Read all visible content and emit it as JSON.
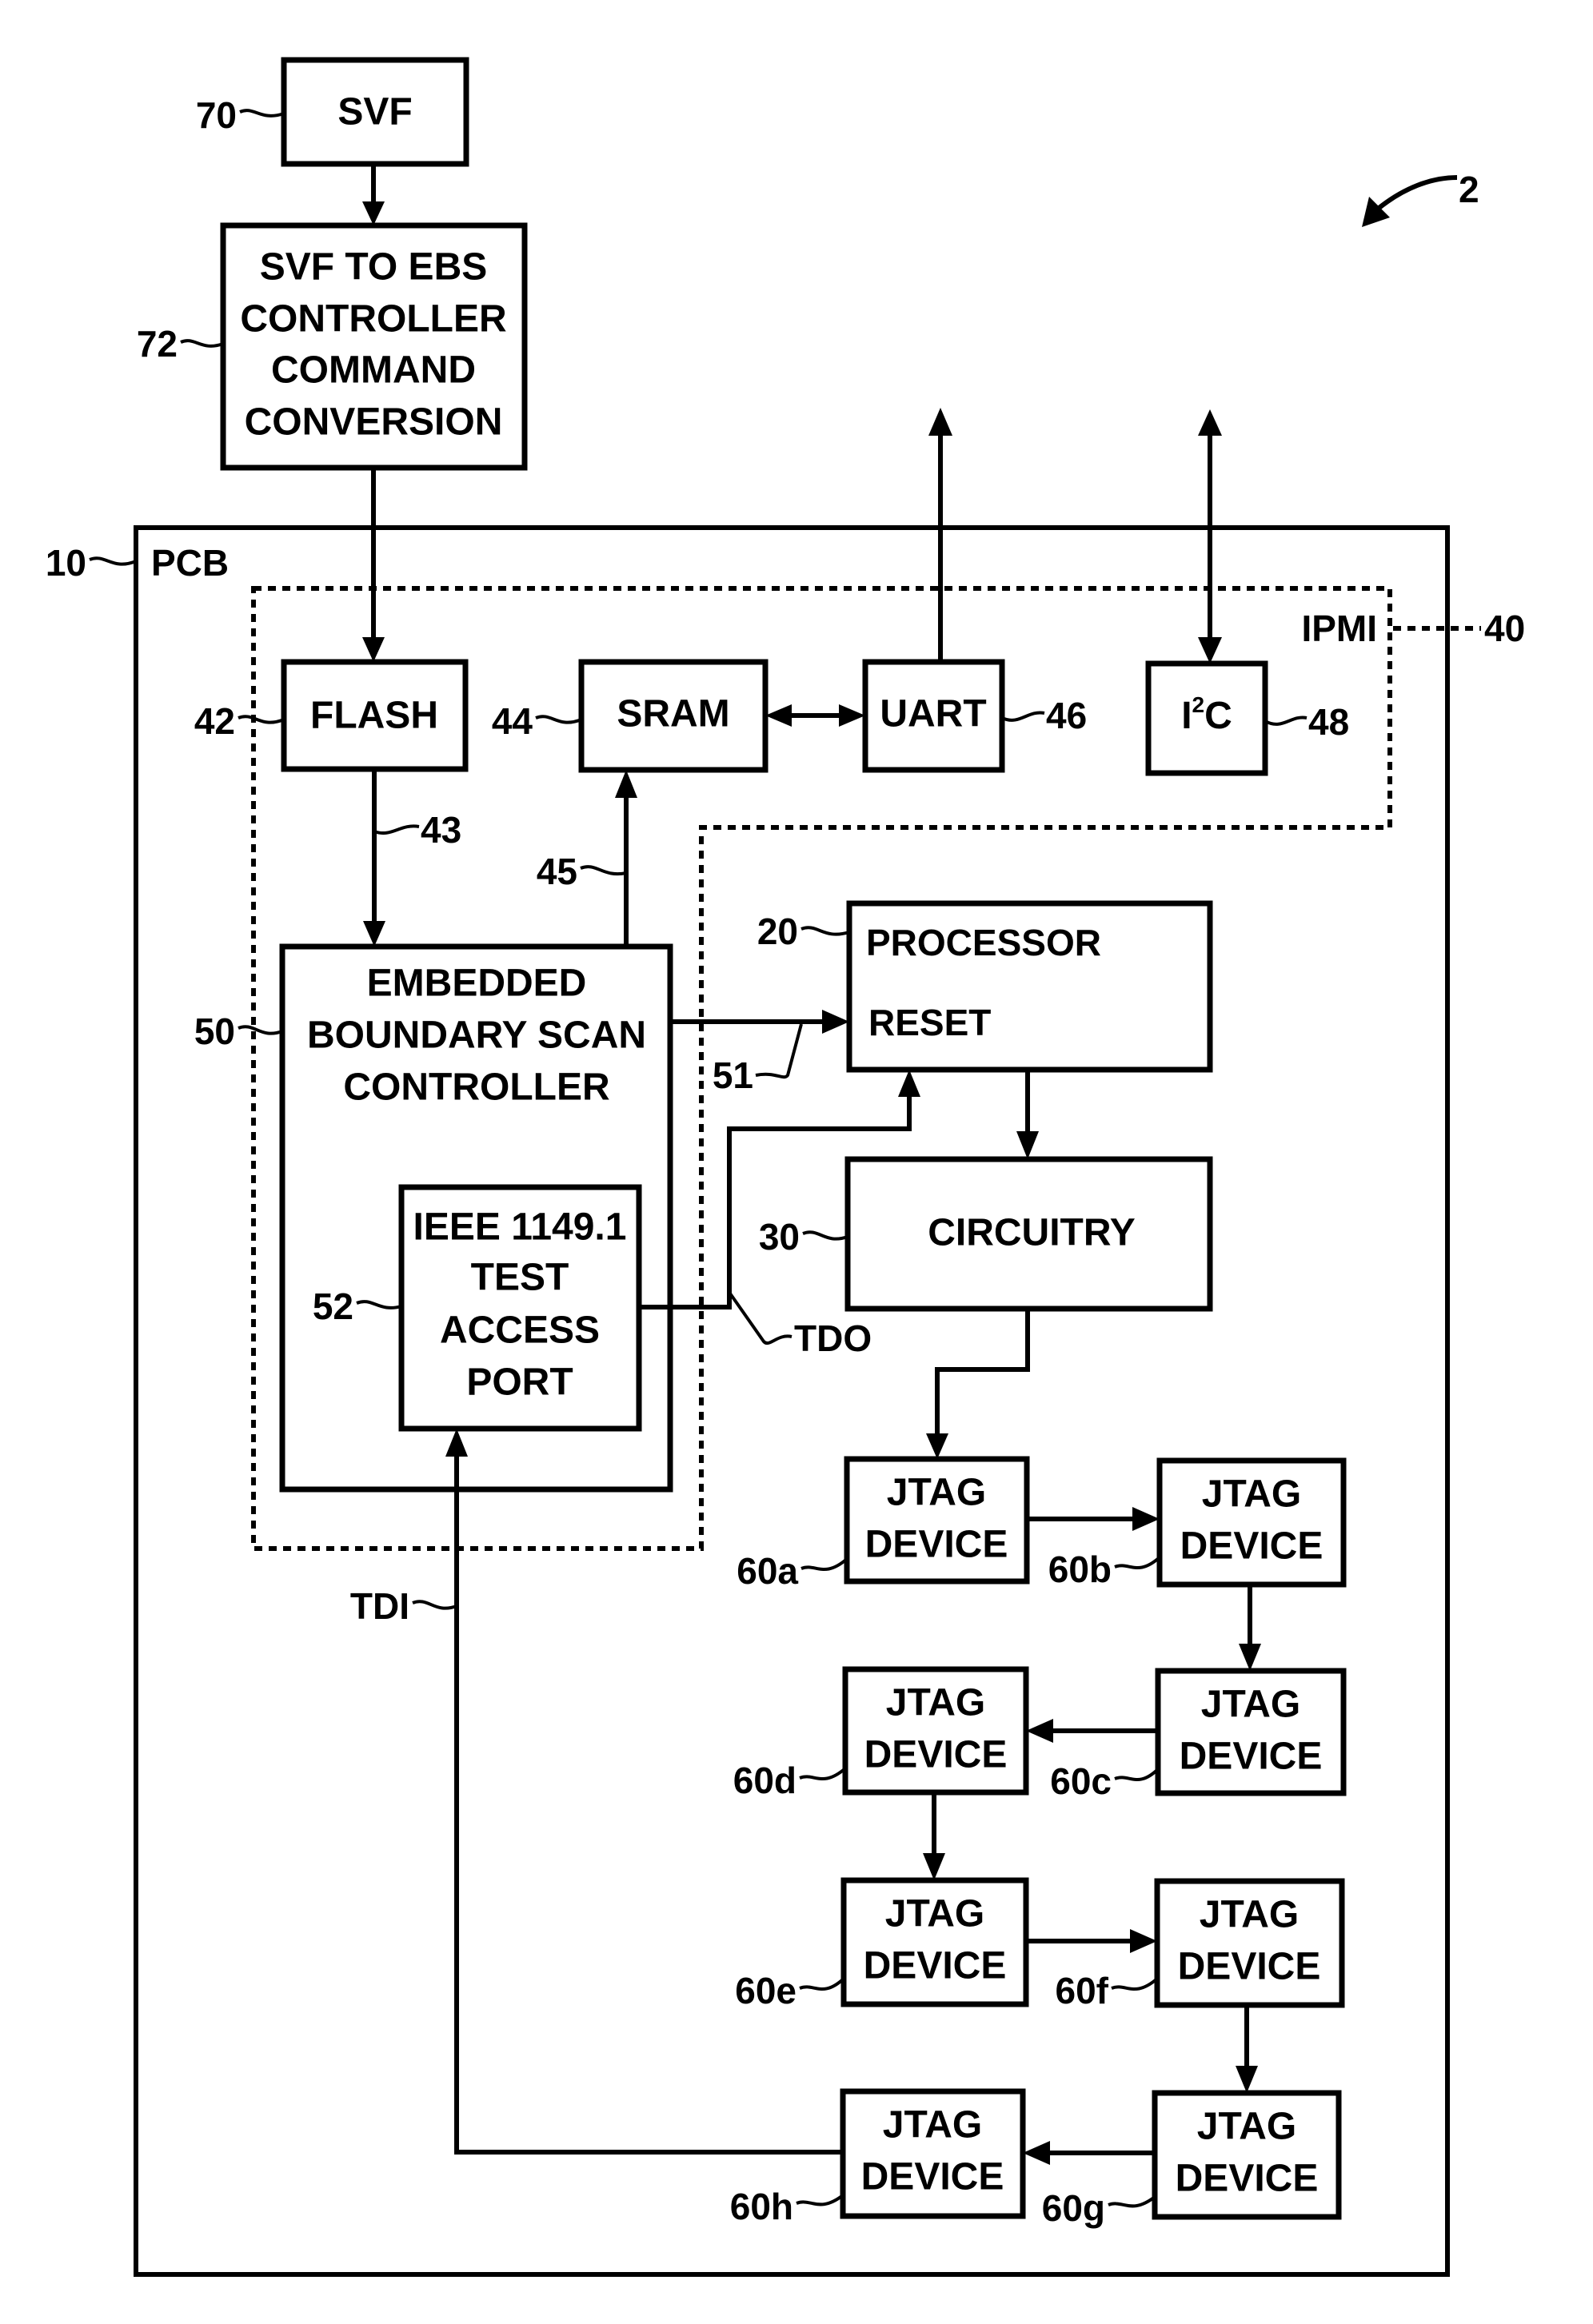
{
  "figure": {
    "figure_ref": "2",
    "blocks": {
      "svf": {
        "ref": "70",
        "lines": [
          "SVF"
        ]
      },
      "conversion": {
        "ref": "72",
        "lines": [
          "SVF TO EBS",
          "CONTROLLER",
          "COMMAND",
          "CONVERSION"
        ]
      },
      "pcb": {
        "ref": "10",
        "label": "PCB"
      },
      "ipmi": {
        "ref": "40",
        "label": "IPMI"
      },
      "flash": {
        "ref": "42",
        "label": "FLASH"
      },
      "sram": {
        "ref": "44",
        "label": "SRAM"
      },
      "uart": {
        "ref": "46",
        "label": "UART"
      },
      "i2c": {
        "ref": "48",
        "label_main": "I",
        "label_sup": "2",
        "label_tail": "C"
      },
      "ebs": {
        "ref": "50",
        "lines": [
          "EMBEDDED",
          "BOUNDARY SCAN",
          "CONTROLLER"
        ]
      },
      "tap": {
        "ref": "52",
        "lines": [
          "IEEE 1149.1",
          "TEST",
          "ACCESS",
          "PORT"
        ]
      },
      "processor": {
        "ref": "20",
        "label": "PROCESSOR",
        "reset_label": "RESET"
      },
      "circuitry": {
        "ref": "30",
        "label": "CIRCUITRY"
      },
      "jtag_devices": [
        {
          "ref": "60a",
          "lines": [
            "JTAG",
            "DEVICE"
          ]
        },
        {
          "ref": "60b",
          "lines": [
            "JTAG",
            "DEVICE"
          ]
        },
        {
          "ref": "60c",
          "lines": [
            "JTAG",
            "DEVICE"
          ]
        },
        {
          "ref": "60d",
          "lines": [
            "JTAG",
            "DEVICE"
          ]
        },
        {
          "ref": "60e",
          "lines": [
            "JTAG",
            "DEVICE"
          ]
        },
        {
          "ref": "60f",
          "lines": [
            "JTAG",
            "DEVICE"
          ]
        },
        {
          "ref": "60g",
          "lines": [
            "JTAG",
            "DEVICE"
          ]
        },
        {
          "ref": "60h",
          "lines": [
            "JTAG",
            "DEVICE"
          ]
        }
      ]
    },
    "connections": {
      "flash_to_ebs_ref": "43",
      "ebs_to_sram_ref": "45",
      "reset_line_ref": "51",
      "tdo_label": "TDO",
      "tdi_label": "TDI"
    }
  }
}
